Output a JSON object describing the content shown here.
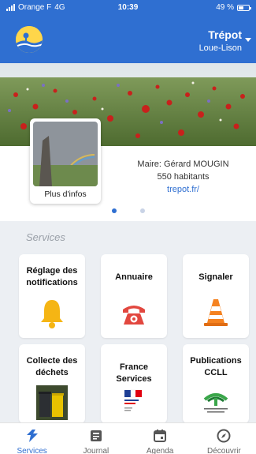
{
  "status_bar": {
    "carrier": "Orange F",
    "network": "4G",
    "time": "10:39",
    "battery": "49 %",
    "battery_level": 0.49
  },
  "header": {
    "city": "Trépot",
    "subtitle": "Loue-Lison"
  },
  "info": {
    "more_info": "Plus d'infos",
    "mayor": "Maire: Gérard MOUGIN",
    "population": "550 habitants",
    "website": "trepot.fr/"
  },
  "carousel": {
    "pages": 2,
    "active": 1
  },
  "services": {
    "title": "Services",
    "tiles": [
      {
        "label": "Réglage des notifications",
        "icon": "bell-icon"
      },
      {
        "label": "Annuaire",
        "icon": "phone-icon"
      },
      {
        "label": "Signaler",
        "icon": "traffic-cone-icon"
      },
      {
        "label": "Collecte des déchets",
        "icon": "garbage-bin-photo"
      },
      {
        "label": "France Services",
        "icon": "france-services-logo"
      },
      {
        "label": "Publications CCLL",
        "icon": "ccll-logo"
      }
    ]
  },
  "nav": {
    "items": [
      {
        "label": "Services",
        "icon": "services-icon",
        "active": true
      },
      {
        "label": "Journal",
        "icon": "journal-icon",
        "active": false
      },
      {
        "label": "Agenda",
        "icon": "calendar-icon",
        "active": false
      },
      {
        "label": "Découvrir",
        "icon": "compass-icon",
        "active": false
      }
    ]
  },
  "colors": {
    "primary": "#2f6fd1",
    "background": "#eceff3",
    "bell": "#f5b514",
    "phone": "#e2473f",
    "cone": "#f58220"
  }
}
